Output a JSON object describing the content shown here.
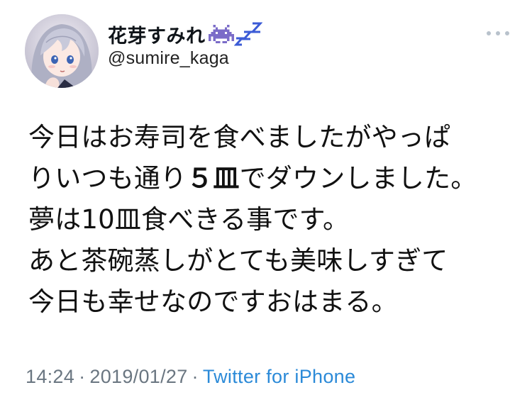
{
  "author": {
    "display_name": "花芽すみれ",
    "handle": "@sumire_kaga",
    "name_icons": [
      "space-invader-icon",
      "zzz-icon"
    ]
  },
  "tweet": {
    "lines": [
      {
        "parts": [
          {
            "text": "今日はお寿司を食べましたがやっぱ",
            "bold": false
          }
        ]
      },
      {
        "parts": [
          {
            "text": "りいつも通り",
            "bold": false
          },
          {
            "text": "５皿",
            "bold": true
          },
          {
            "text": "でダウンしました。",
            "bold": false
          }
        ]
      },
      {
        "parts": [
          {
            "text": "夢は10皿食べきる事です。",
            "bold": false
          }
        ]
      },
      {
        "parts": [
          {
            "text": "あと茶碗蒸しがとても美味しすぎて",
            "bold": false
          }
        ]
      },
      {
        "parts": [
          {
            "text": "今日も幸せなのですおはまる。",
            "bold": false
          }
        ]
      }
    ]
  },
  "meta": {
    "time": "14:24",
    "separator": "·",
    "date": "2019/01/27",
    "source": "Twitter for iPhone"
  },
  "colors": {
    "source_link": "#2b8ad8",
    "meta_text": "#6a7681",
    "invader": "#7b6cc8",
    "zzz": "#3b5bd6"
  }
}
